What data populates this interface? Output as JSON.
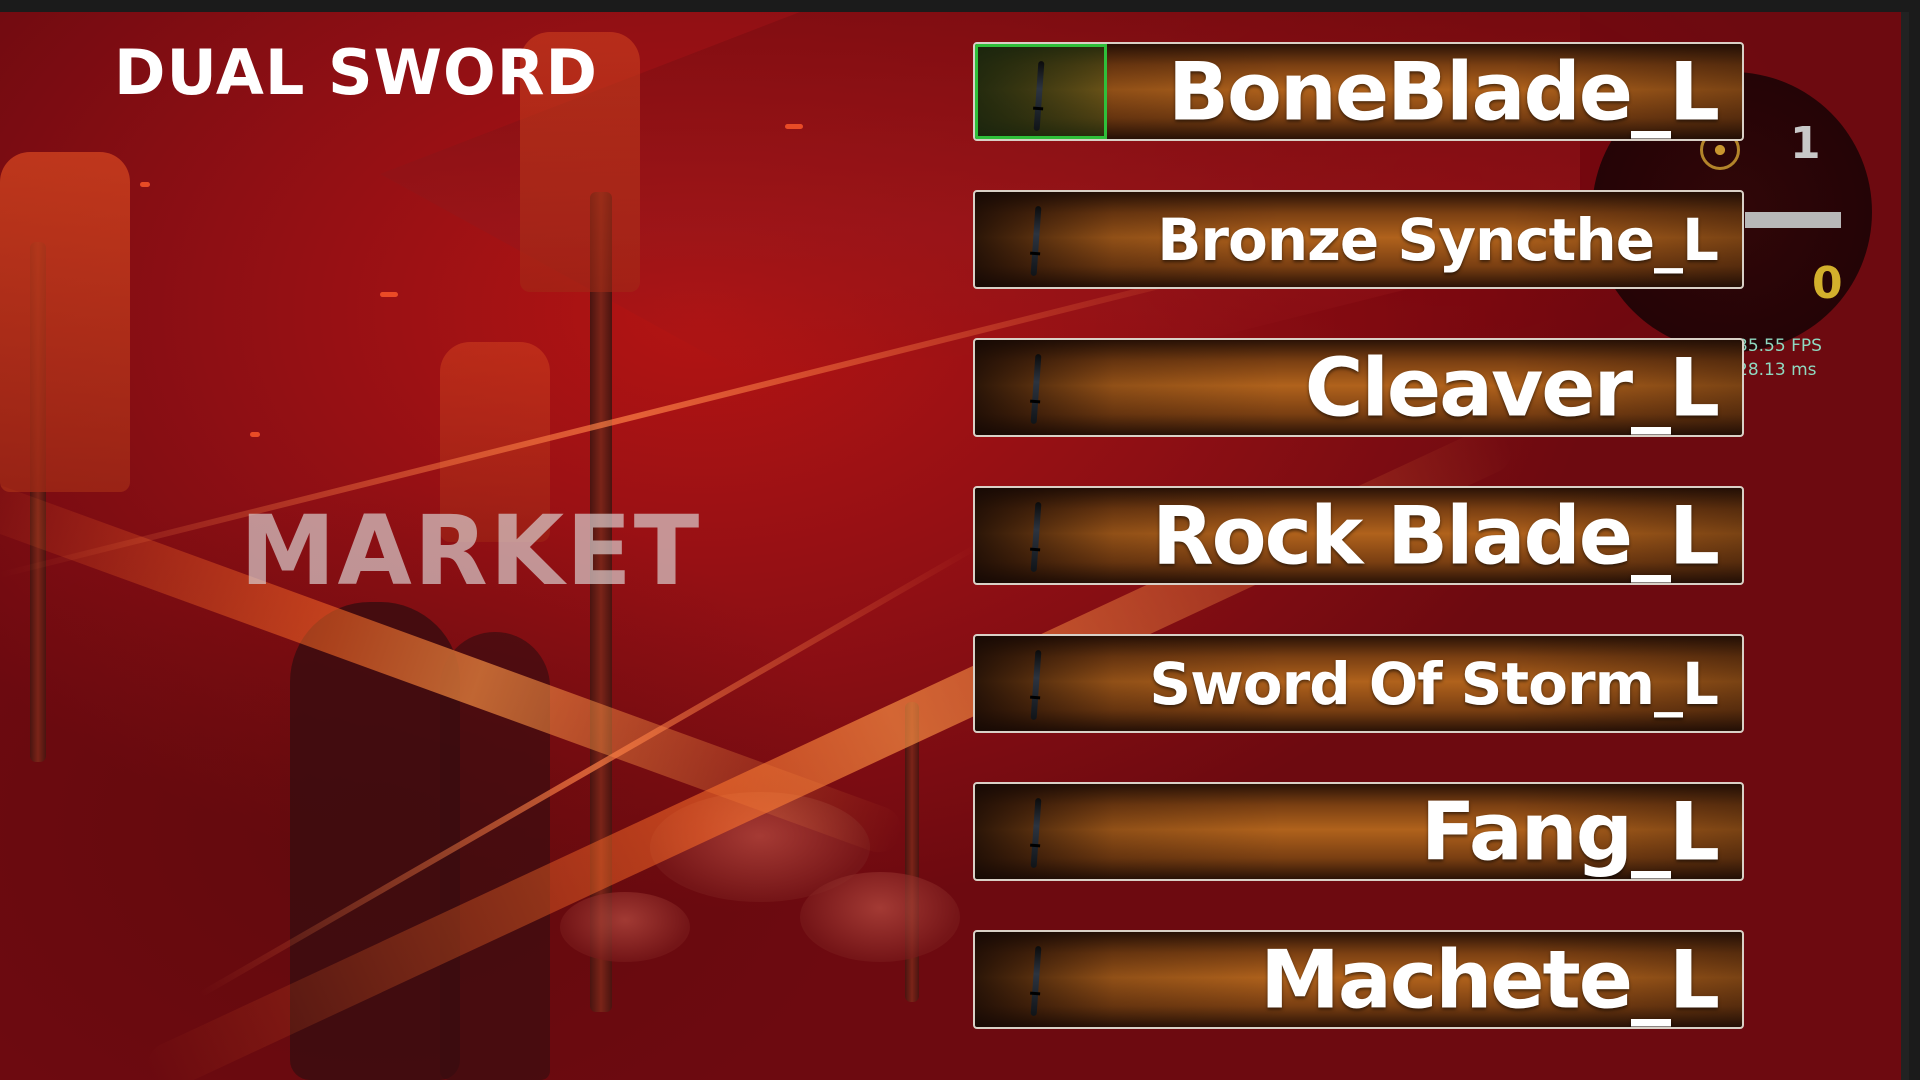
{
  "screen": {
    "category_title": "DUAL SWORD",
    "location_label": "MARKET"
  },
  "hud": {
    "top_counter": "1",
    "bottom_counter": "0",
    "fps": "35.55 FPS",
    "frame_time": "28.13 ms"
  },
  "colors": {
    "selected_outline": "#2fbf3a",
    "button_gold": "#b0621c",
    "counter_gold": "#d3b02c",
    "background_red": "#b31413"
  },
  "weapons": [
    {
      "name": "BoneBlade_L",
      "selected": true,
      "icon": "sword-icon"
    },
    {
      "name": "Bronze Syncthe_L",
      "selected": false,
      "icon": "sword-icon"
    },
    {
      "name": "Cleaver_L",
      "selected": false,
      "icon": "sword-icon"
    },
    {
      "name": "Rock Blade_L",
      "selected": false,
      "icon": "sword-icon"
    },
    {
      "name": "Sword Of Storm_L",
      "selected": false,
      "icon": "sword-icon"
    },
    {
      "name": "Fang_L",
      "selected": false,
      "icon": "sword-icon"
    },
    {
      "name": "Machete_L",
      "selected": false,
      "icon": "sword-icon"
    }
  ]
}
